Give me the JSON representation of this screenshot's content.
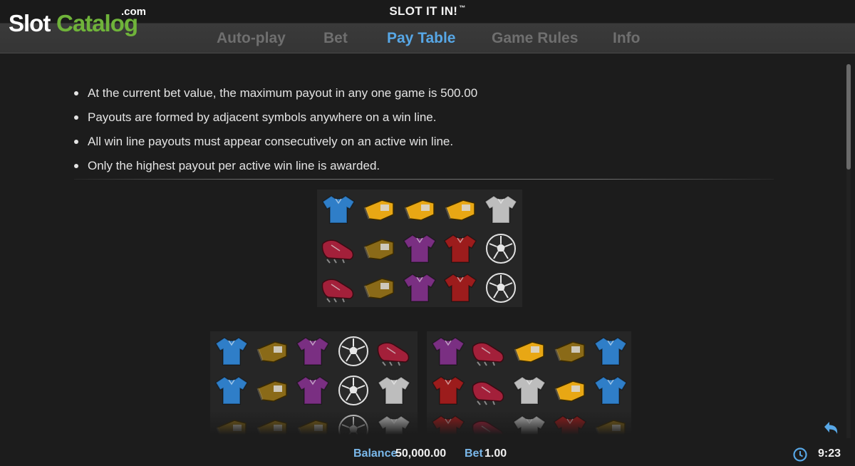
{
  "header": {
    "title": "SLOT IT IN!",
    "title_mark": "™",
    "logo": {
      "part1": "Slot",
      "part2": "Catalog",
      "suffix": ".com"
    },
    "tabs": [
      {
        "label": "Auto-play",
        "active": false
      },
      {
        "label": "Bet",
        "active": false
      },
      {
        "label": "Pay Table",
        "active": true
      },
      {
        "label": "Game Rules",
        "active": false
      },
      {
        "label": "Info",
        "active": false
      }
    ]
  },
  "rules": [
    "At the current bet value, the maximum payout in any one game is 500.00",
    "Payouts are formed by adjacent symbols anywhere on a win line.",
    "All win line payouts must appear consecutively on an active win line.",
    "Only the highest payout per active win line is awarded."
  ],
  "symbols": {
    "blue-jersey": {
      "color": "#2f7ec8",
      "icon": "jersey-icon"
    },
    "gold-whistle": {
      "color": "#e8a714",
      "icon": "whistle-icon"
    },
    "dark-whistle": {
      "color": "#8a6a18",
      "icon": "whistle-icon"
    },
    "white-jersey": {
      "color": "#bdbdbd",
      "icon": "jersey-icon"
    },
    "red-boot": {
      "color": "#a3203a",
      "icon": "boot-icon"
    },
    "purple-jersey": {
      "color": "#7a2f82",
      "icon": "jersey-icon"
    },
    "red-jersey": {
      "color": "#9c1c1c",
      "icon": "jersey-icon"
    },
    "ball": {
      "color": "#2a2a2a",
      "icon": "ball-icon"
    }
  },
  "grids": [
    {
      "name": "reel-grid-top",
      "rows": [
        [
          "blue-jersey",
          "gold-whistle",
          "gold-whistle",
          "gold-whistle",
          "white-jersey"
        ],
        [
          "red-boot",
          "dark-whistle",
          "purple-jersey",
          "red-jersey",
          "ball"
        ],
        [
          "red-boot",
          "dark-whistle",
          "purple-jersey",
          "red-jersey",
          "ball"
        ]
      ]
    },
    {
      "name": "reel-grid-bottom-left",
      "rows": [
        [
          "blue-jersey",
          "dark-whistle",
          "purple-jersey",
          "ball",
          "red-boot"
        ],
        [
          "blue-jersey",
          "dark-whistle",
          "purple-jersey",
          "ball",
          "white-jersey"
        ],
        [
          "dark-whistle",
          "dark-whistle",
          "dark-whistle",
          "ball",
          "white-jersey"
        ]
      ]
    },
    {
      "name": "reel-grid-bottom-right",
      "rows": [
        [
          "purple-jersey",
          "red-boot",
          "gold-whistle",
          "dark-whistle",
          "blue-jersey"
        ],
        [
          "red-jersey",
          "red-boot",
          "white-jersey",
          "gold-whistle",
          "blue-jersey"
        ],
        [
          "red-jersey",
          "red-boot",
          "white-jersey",
          "red-jersey",
          "dark-whistle"
        ]
      ]
    }
  ],
  "status": {
    "balance_label": "Balance",
    "balance_value": "50,000.00",
    "bet_label": "Bet",
    "bet_value": "1.00",
    "time": "9:23"
  },
  "colors": {
    "accent": "#57a7e6",
    "tab_inactive": "#6f6f6f",
    "background": "#1c1c1c"
  }
}
